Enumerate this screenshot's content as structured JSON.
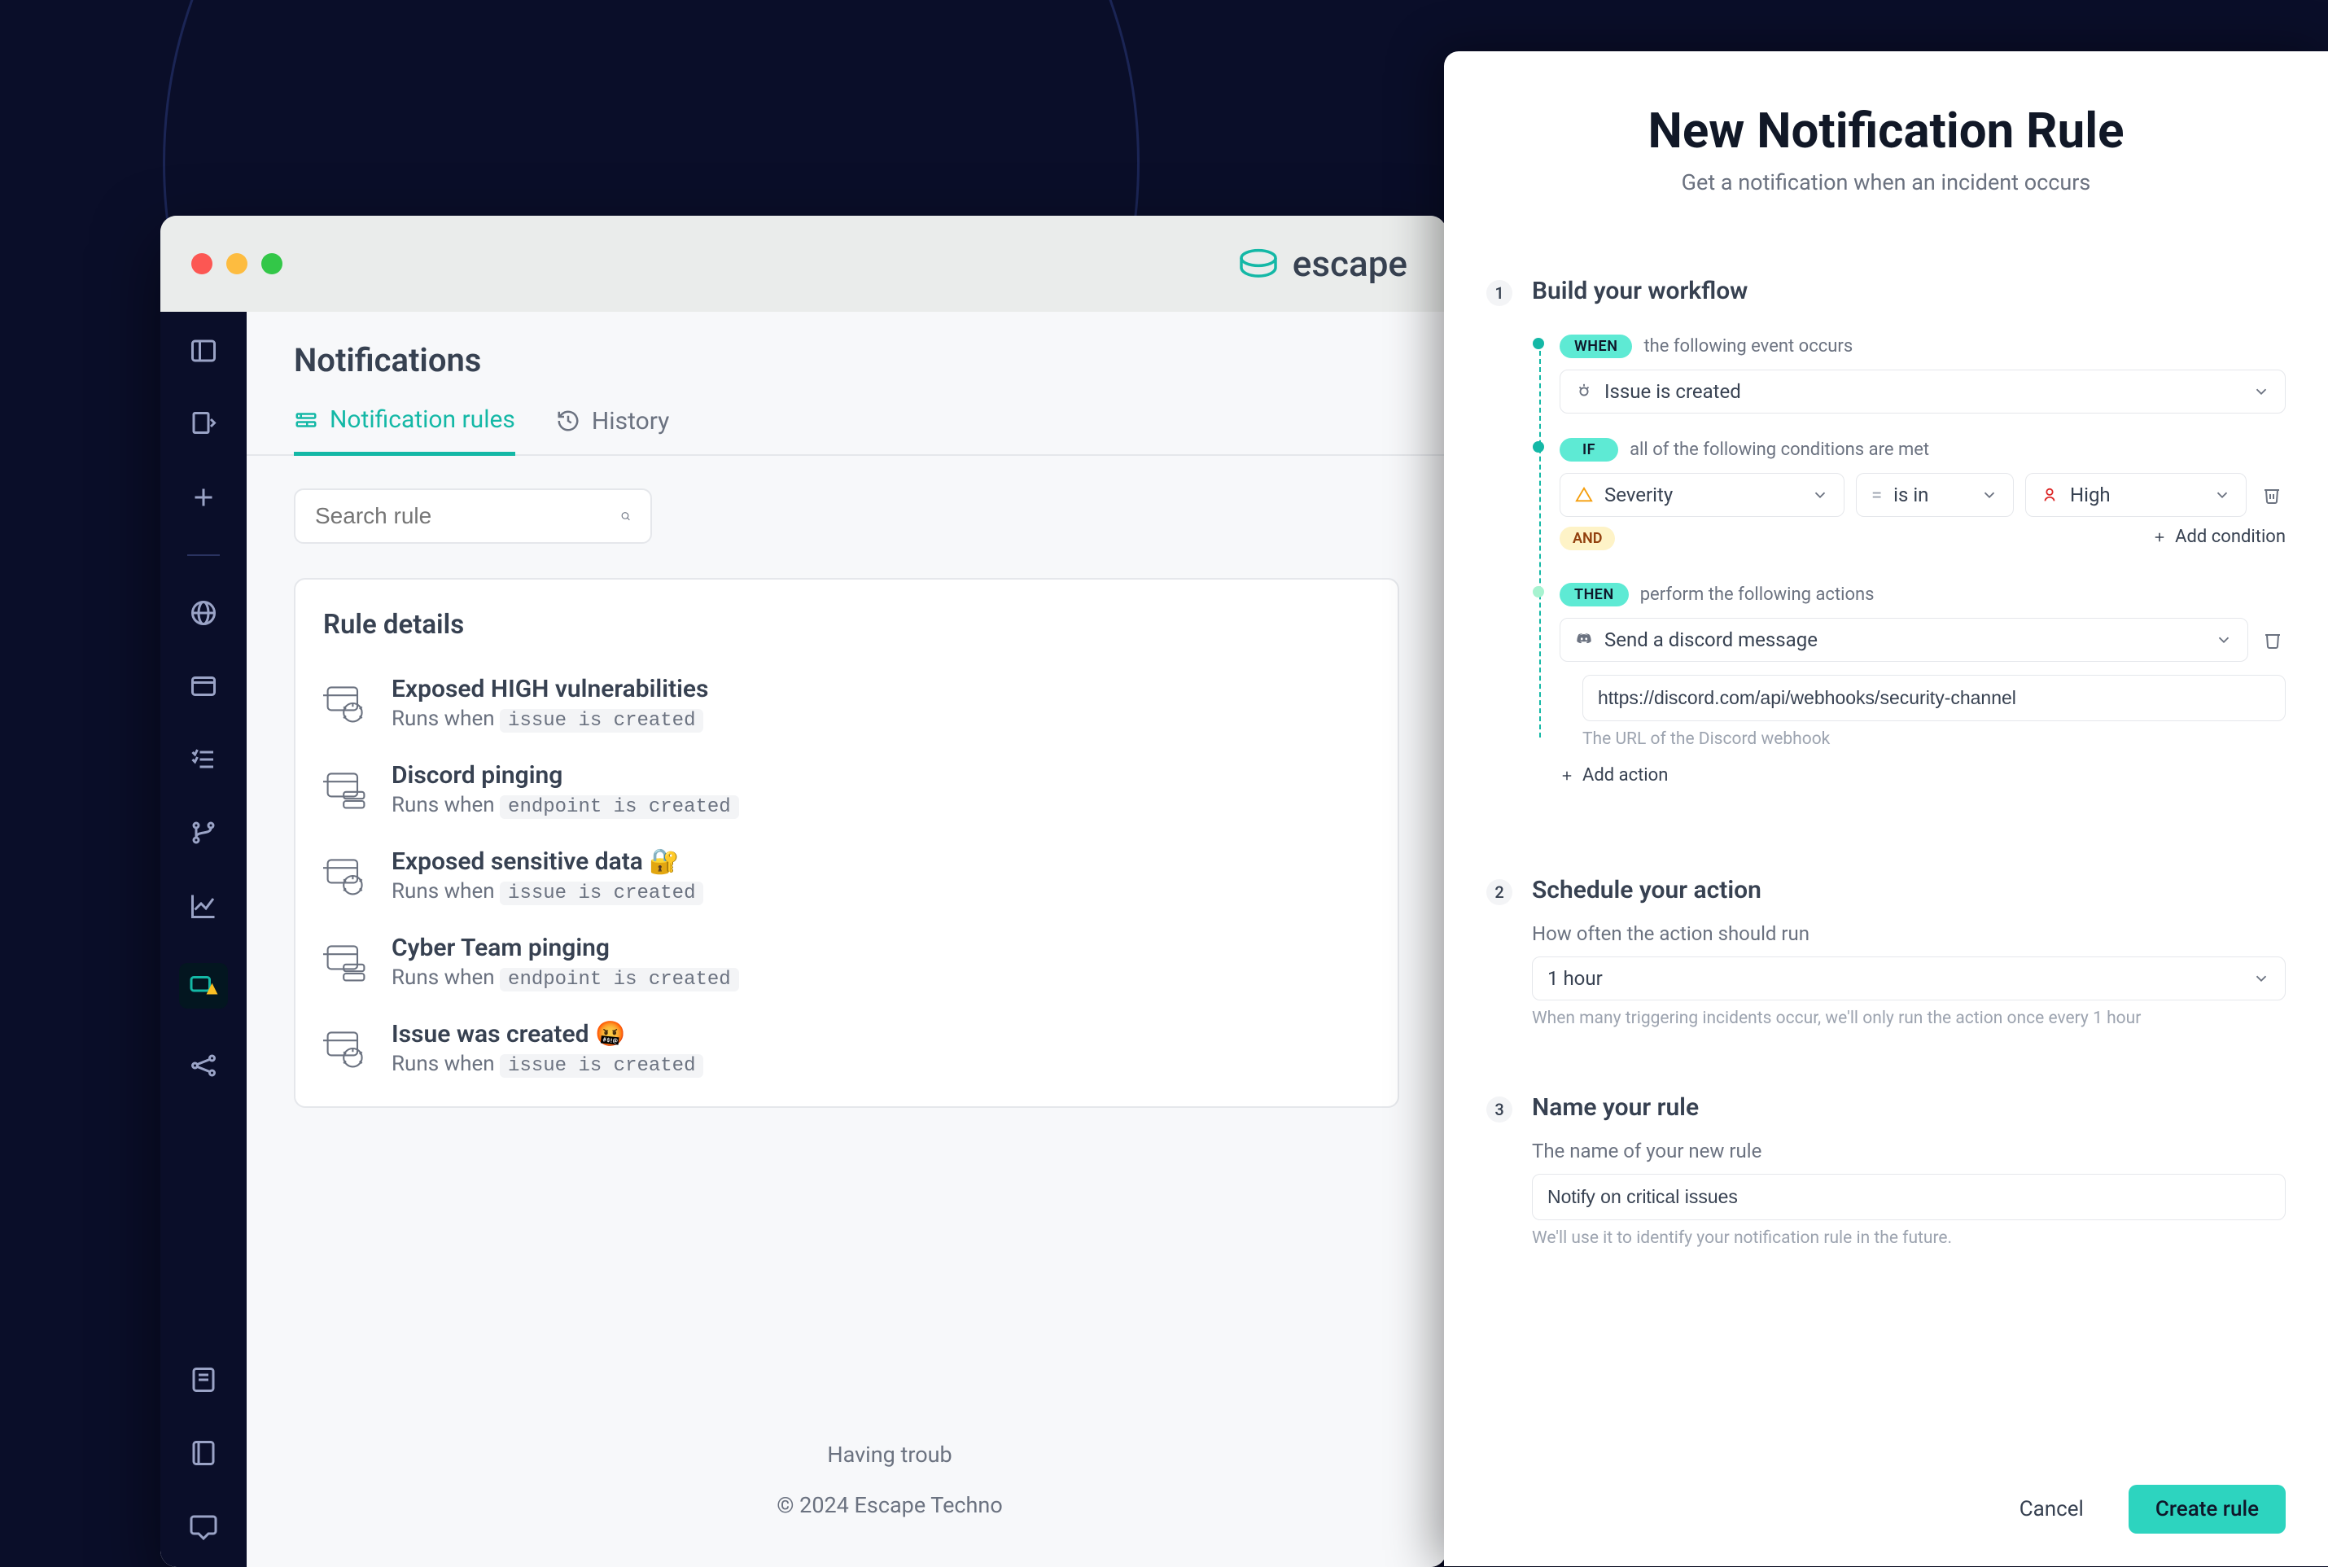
{
  "brand": "escape",
  "page_title": "Notifications",
  "tabs": {
    "rules": "Notification rules",
    "history": "History"
  },
  "search_placeholder": "Search rule",
  "rules_panel_title": "Rule details",
  "rules": [
    {
      "name": "Exposed HIGH vulnerabilities",
      "runs_prefix": "Runs when",
      "trigger": "issue is created",
      "icon": "issue"
    },
    {
      "name": "Discord pinging",
      "runs_prefix": "Runs when",
      "trigger": "endpoint is created",
      "icon": "endpoint"
    },
    {
      "name": "Exposed sensitive data 🔐",
      "runs_prefix": "Runs when",
      "trigger": "issue is created",
      "icon": "issue"
    },
    {
      "name": "Cyber Team pinging",
      "runs_prefix": "Runs when",
      "trigger": "endpoint is created",
      "icon": "endpoint"
    },
    {
      "name": "Issue was created 🤬",
      "runs_prefix": "Runs when",
      "trigger": "issue is created",
      "icon": "issue"
    }
  ],
  "footer": {
    "line1": "Having troub",
    "line2": "© 2024 Escape Techno"
  },
  "modal": {
    "title": "New Notification Rule",
    "subtitle": "Get a notification when an incident occurs",
    "step1": {
      "num": "1",
      "title": "Build your workflow",
      "when_pill": "WHEN",
      "when_sub": "the following event occurs",
      "when_sel": "Issue is created",
      "if_pill": "IF",
      "if_sub": "all of the following conditions are met",
      "cond_field": "Severity",
      "cond_op": "is in",
      "cond_val": "High",
      "and_pill": "AND",
      "add_condition": "Add condition",
      "then_pill": "THEN",
      "then_sub": "perform the following actions",
      "action_sel": "Send a discord message",
      "webhook_value": "https://discord.com/api/webhooks/security-channel",
      "webhook_help": "The URL of the Discord webhook",
      "add_action": "Add action"
    },
    "step2": {
      "num": "2",
      "title": "Schedule your action",
      "label": "How often the action should run",
      "value": "1 hour",
      "help": "When many triggering incidents occur, we'll only run the action once every 1 hour"
    },
    "step3": {
      "num": "3",
      "title": "Name your rule",
      "label": "The name of your new rule",
      "value": "Notify on critical issues",
      "help": "We'll use it to identify your notification rule in the future."
    },
    "cancel": "Cancel",
    "create": "Create rule"
  }
}
